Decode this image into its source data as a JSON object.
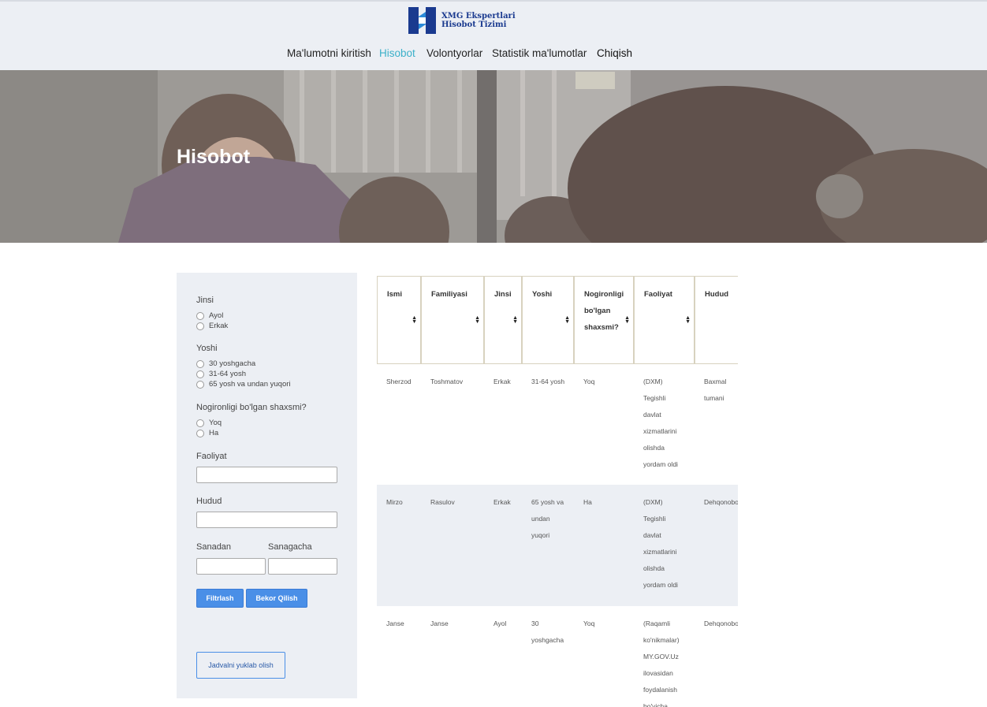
{
  "logo": {
    "line1": "XMG Ekspertlari",
    "line2": "Hisobot Tizimi"
  },
  "nav": {
    "items": [
      {
        "label": "Ma'lumotni kiritish"
      },
      {
        "label": "Hisobot"
      },
      {
        "label": "Volontyorlar"
      },
      {
        "label": "Statistik ma'lumotlar"
      },
      {
        "label": "Chiqish"
      }
    ]
  },
  "hero": {
    "title": "Hisobot"
  },
  "filters": {
    "gender": {
      "label": "Jinsi",
      "options": [
        "Ayol",
        "Erkak"
      ]
    },
    "age": {
      "label": "Yoshi",
      "options": [
        "30 yoshgacha",
        "31-64 yosh",
        "65 yosh va undan yuqori"
      ]
    },
    "disability": {
      "label": "Nogironligi bo'lgan shaxsmi?",
      "options": [
        "Yoq",
        "Ha"
      ]
    },
    "activity": {
      "label": "Faoliyat",
      "value": ""
    },
    "region": {
      "label": "Hudud",
      "value": ""
    },
    "date_from": {
      "label": "Sanadan",
      "value": ""
    },
    "date_to": {
      "label": "Sanagacha",
      "value": ""
    },
    "filter_button": "Filtrlash",
    "cancel_button": "Bekor Qilish",
    "download_button": "Jadvalni yuklab olish"
  },
  "colors": {
    "accent": "#4a8fe7",
    "nav_active": "#3bb0c9",
    "panel_bg": "#eceff4"
  },
  "table": {
    "headers": [
      "Ismi",
      "Familiyasi",
      "Jinsi",
      "Yoshi",
      "Nogironligi bo'lgan shaxsmi?",
      "Faoliyat",
      "Hudud"
    ],
    "rows": [
      [
        "Sherzod",
        "Toshmatov",
        "Erkak",
        "31-64 yosh",
        "Yoq",
        "(DXM) Tegishli davlat xizmatlarini olishda yordam oldi",
        "Baxmal tumani"
      ],
      [
        "Mirzo",
        "Rasulov",
        "Erkak",
        "65 yosh va undan yuqori",
        "Ha",
        "(DXM) Tegishli davlat xizmatlarini olishda yordam oldi",
        "Dehqonobod tumani"
      ],
      [
        "Janse",
        "Janse",
        "Ayol",
        "30 yoshgacha",
        "Yoq",
        "(Raqamli ko'nikmalar) MY.GOV.Uz ilovasidan foydalanish bo'yicha",
        "Dehqonobod tumani"
      ]
    ]
  }
}
